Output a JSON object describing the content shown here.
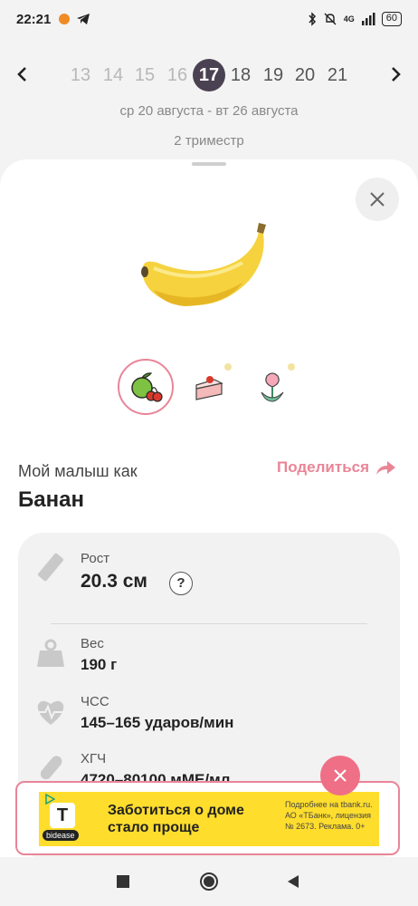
{
  "status_bar": {
    "time": "22:21",
    "network": "4G",
    "battery": "60"
  },
  "week_nav": {
    "weeks": [
      "13",
      "14",
      "15",
      "16",
      "17",
      "18",
      "19",
      "20",
      "21"
    ],
    "active_week": "17",
    "date_range": "ср 20 августа - вт 26 августа",
    "trimester": "2 триместр"
  },
  "comparison": {
    "label": "Мой малыш как",
    "fruit": "Банан",
    "share_label": "Поделиться",
    "categories": [
      "fruits",
      "sweets",
      "flowers"
    ],
    "active_category": "fruits"
  },
  "stats": {
    "height": {
      "label": "Рост",
      "value": "20.3 см",
      "help": "?"
    },
    "weight": {
      "label": "Вес",
      "value": "190 г"
    },
    "heart_rate": {
      "label": "ЧСС",
      "value": "145–165 ударов/мин"
    },
    "hcg": {
      "label": "ХГЧ",
      "value": "4720–80100 мМЕ/мл"
    }
  },
  "ad": {
    "logo": "Т",
    "badge": "bidease",
    "headline": "Заботиться о доме стало проще",
    "disclaimer": "Подробнее на tbank.ru. АО «ТБанк», лицензия № 2673. Реклама. 0+"
  },
  "colors": {
    "accent": "#e98597",
    "active_week_bg": "#4a4252",
    "ad_yellow": "#ffdd2d",
    "ad_close": "#ef6f86"
  }
}
